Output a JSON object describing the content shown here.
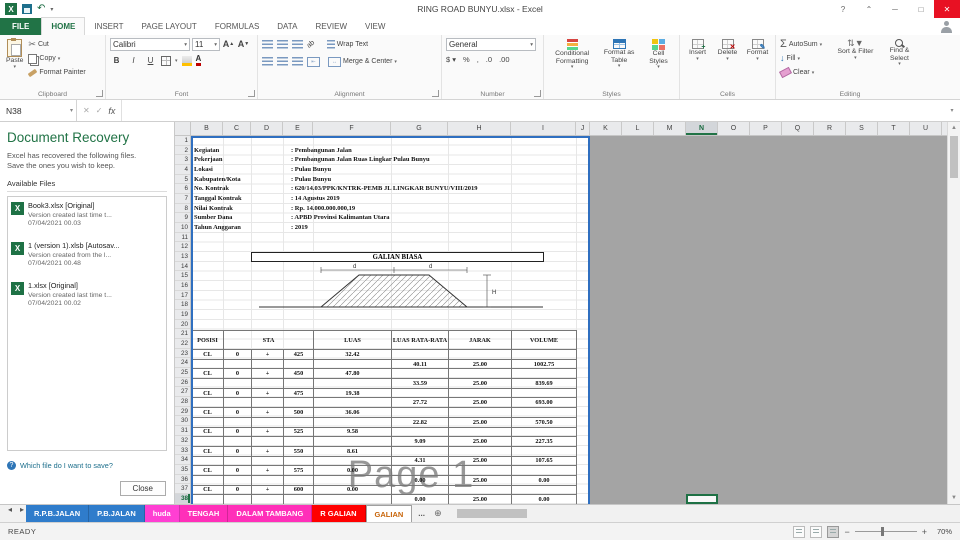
{
  "titlebar": {
    "title": "RING ROAD BUNYU.xlsx - Excel"
  },
  "ribbon_tabs": [
    {
      "label": "FILE"
    },
    {
      "label": "HOME"
    },
    {
      "label": "INSERT"
    },
    {
      "label": "PAGE LAYOUT"
    },
    {
      "label": "FORMULAS"
    },
    {
      "label": "DATA"
    },
    {
      "label": "REVIEW"
    },
    {
      "label": "VIEW"
    }
  ],
  "ribbon": {
    "clipboard": {
      "group": "Clipboard",
      "paste": "Paste",
      "cut": "Cut",
      "copy": "Copy",
      "format_painter": "Format Painter"
    },
    "font": {
      "group": "Font",
      "font_name": "Calibri",
      "font_size": "11",
      "bold": "B",
      "italic": "I",
      "underline": "U"
    },
    "alignment": {
      "group": "Alignment",
      "wrap_text": "Wrap Text",
      "merge_center": "Merge & Center"
    },
    "number": {
      "group": "Number",
      "format": "General"
    },
    "styles": {
      "group": "Styles",
      "conditional": "Conditional Formatting",
      "format_table": "Format as Table",
      "cell_styles": "Cell Styles"
    },
    "cells": {
      "group": "Cells",
      "insert": "Insert",
      "delete": "Delete",
      "format": "Format"
    },
    "editing": {
      "group": "Editing",
      "autosum_symbol": "Σ",
      "autosum": "AutoSum",
      "fill": "Fill",
      "clear": "Clear",
      "sort": "Sort & Filter",
      "find": "Find & Select"
    }
  },
  "formula_bar": {
    "name_box": "N38",
    "fx": "fx"
  },
  "recovery": {
    "title": "Document Recovery",
    "intro1": "Excel has recovered the following files.",
    "intro2": "Save the ones you wish to keep.",
    "available_label": "Available Files",
    "files": [
      {
        "name": "Book3.xlsx  [Original]",
        "desc": "Version created last time t...",
        "date": "07/04/2021 00.03"
      },
      {
        "name": "1 (version 1).xlsb  [Autosav...",
        "desc": "Version created from the l...",
        "date": "07/04/2021 00.48"
      },
      {
        "name": "1.xlsx  [Original]",
        "desc": "Version created last time t...",
        "date": "07/04/2021 00.02"
      }
    ],
    "help_link": "Which file do I want to save?",
    "close_label": "Close"
  },
  "sheet": {
    "selected_cell": "N38",
    "columns_white": [
      "B",
      "C",
      "D",
      "E",
      "F",
      "G",
      "H",
      "I",
      "J"
    ],
    "columns_gray": [
      "K",
      "L",
      "M",
      "N",
      "O",
      "P",
      "Q",
      "R",
      "S",
      "T",
      "U"
    ],
    "selected_column": "N",
    "selected_row": 38,
    "row_count": 38,
    "info_rows": [
      {
        "row": 2,
        "label": "Kegiatan",
        "value": ": Pembangunan Jalan"
      },
      {
        "row": 3,
        "label": "Pekerjaan",
        "value": ": Pembangunan Jalan Ruas Lingkar Pulau Bunyu"
      },
      {
        "row": 4,
        "label": "Lokasi",
        "value": ": Pulau Bunyu"
      },
      {
        "row": 5,
        "label": "Kabupaten/Kota",
        "value": ": Pulau Bunyu"
      },
      {
        "row": 6,
        "label": "No. Kontrak",
        "value": ": 620/14.03/PPK/KNTRK-PEMB JL LINGKAR BUNYU/VIII/2019"
      },
      {
        "row": 7,
        "label": "Tanggal Kontrak",
        "value": ": 14 Agustus 2019"
      },
      {
        "row": 8,
        "label": "Nilai Kontrak",
        "value": ": Rp. 14.000.000.000,19"
      },
      {
        "row": 9,
        "label": "Sumber Dana",
        "value": ": APBD Provinsi Kalimantan Utara"
      },
      {
        "row": 10,
        "label": "Tahun Anggaran",
        "value": ": 2019"
      }
    ],
    "section_title": "GALIAN BIASA",
    "diagram_labels": {
      "d_left": "d",
      "d_right": "d",
      "h": "H"
    },
    "table": {
      "headers": [
        "POSISI",
        "STA",
        "LUAS",
        "LUAS RATA-RATA",
        "JARAK",
        "VOLUME"
      ],
      "rows": [
        [
          "CL",
          "0",
          "+",
          "425",
          "32.42",
          "",
          "",
          ""
        ],
        [
          "",
          "",
          "",
          "",
          "",
          "40.11",
          "25.00",
          "1002.75"
        ],
        [
          "CL",
          "0",
          "+",
          "450",
          "47.80",
          "",
          "",
          ""
        ],
        [
          "",
          "",
          "",
          "",
          "",
          "33.59",
          "25.00",
          "839.69"
        ],
        [
          "CL",
          "0",
          "+",
          "475",
          "19.38",
          "",
          "",
          ""
        ],
        [
          "",
          "",
          "",
          "",
          "",
          "27.72",
          "25.00",
          "693.00"
        ],
        [
          "CL",
          "0",
          "+",
          "500",
          "36.06",
          "",
          "",
          ""
        ],
        [
          "",
          "",
          "",
          "",
          "",
          "22.82",
          "25.00",
          "570.50"
        ],
        [
          "CL",
          "0",
          "+",
          "525",
          "9.58",
          "",
          "",
          ""
        ],
        [
          "",
          "",
          "",
          "",
          "",
          "9.09",
          "25.00",
          "227.35"
        ],
        [
          "CL",
          "0",
          "+",
          "550",
          "8.61",
          "",
          "",
          ""
        ],
        [
          "",
          "",
          "",
          "",
          "",
          "4.31",
          "25.00",
          "107.65"
        ],
        [
          "CL",
          "0",
          "+",
          "575",
          "0.00",
          "",
          "",
          ""
        ],
        [
          "",
          "",
          "",
          "",
          "",
          "0.00",
          "25.00",
          "0.00"
        ],
        [
          "CL",
          "0",
          "+",
          "600",
          "0.00",
          "",
          "",
          ""
        ],
        [
          "",
          "",
          "",
          "",
          "",
          "0.00",
          "25.00",
          "0.00"
        ]
      ]
    },
    "watermark": "Page 1"
  },
  "sheet_tabs": {
    "tabs": [
      {
        "label": "R.P.B.JALAN",
        "bg": "#2F7CCB",
        "fg": "#FFFFFF",
        "active": false
      },
      {
        "label": "P.B.JALAN",
        "bg": "#2F7CCB",
        "fg": "#FFFFFF",
        "active": false
      },
      {
        "label": "huda",
        "bg": "#FF3FD3",
        "fg": "#FFFFFF",
        "active": false
      },
      {
        "label": "TENGAH",
        "bg": "#FF2FB9",
        "fg": "#FFFFFF",
        "active": false
      },
      {
        "label": "DALAM TAMBANG",
        "bg": "#FF2FB9",
        "fg": "#FFFFFF",
        "active": false
      },
      {
        "label": "R GALIAN",
        "bg": "#FF0000",
        "fg": "#FFFFFF",
        "active": false
      },
      {
        "label": "GALIAN",
        "bg": "#FFFFFF",
        "fg": "#C8650A",
        "active": true
      }
    ],
    "overflow": "..."
  },
  "status_bar": {
    "mode": "READY",
    "zoom": "70%"
  }
}
